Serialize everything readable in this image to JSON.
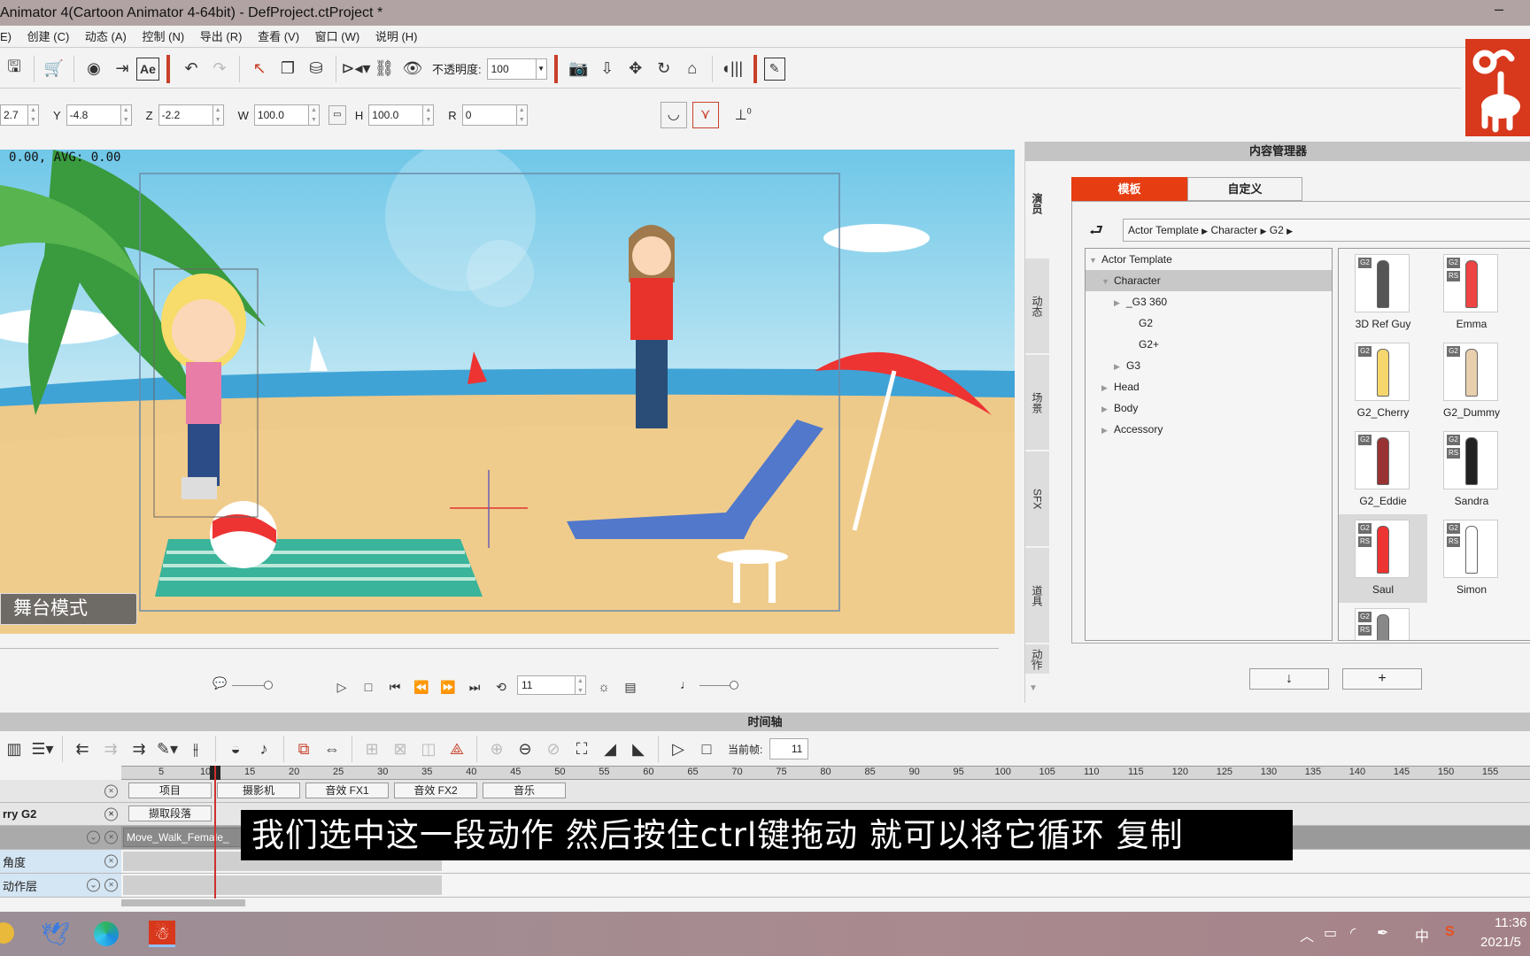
{
  "window": {
    "title": "Animator 4(Cartoon Animator 4-64bit) - DefProject.ctProject *",
    "minimize": "–"
  },
  "menu": [
    "E)",
    "创建 (C)",
    "动态 (A)",
    "控制 (N)",
    "导出 (R)",
    "查看 (V)",
    "窗口 (W)",
    "说明 (H)"
  ],
  "toolbar": {
    "ae_label": "Ae",
    "opacity_label": "不透明度:",
    "opacity_value": "100"
  },
  "transform": {
    "x": "2.7",
    "y_label": "Y",
    "y": "-4.8",
    "z_label": "Z",
    "z": "-2.2",
    "w_label": "W",
    "w": "100.0",
    "h_label": "H",
    "h": "100.0",
    "r_label": "R",
    "r": "0",
    "angle_zero": "0"
  },
  "stage": {
    "fps": "0.00, AVG: 0.00",
    "mode": "舞台模式",
    "frame": "11"
  },
  "content_manager": {
    "title": "内容管理器",
    "side_tabs": [
      "演员",
      "动态",
      "场景",
      "SFX",
      "道具",
      "动作"
    ],
    "tabs": [
      "模板",
      "自定义"
    ],
    "breadcrumb": [
      "Actor Template",
      "Character",
      "G2"
    ],
    "tree": [
      {
        "label": "Actor Template",
        "expanded": true
      },
      {
        "label": "Character",
        "expanded": true,
        "selected": true
      },
      {
        "label": "_G3 360",
        "expandable": true
      },
      {
        "label": "G2"
      },
      {
        "label": "G2+"
      },
      {
        "label": "G3",
        "expandable": true
      },
      {
        "label": "Head",
        "expandable": true
      },
      {
        "label": "Body",
        "expandable": true
      },
      {
        "label": "Accessory",
        "expandable": true
      }
    ],
    "items": [
      {
        "name": "3D Ref Guy",
        "badges": [
          "G2"
        ]
      },
      {
        "name": "Emma",
        "badges": [
          "G2",
          "RS"
        ]
      },
      {
        "name": "G2_Cherry",
        "badges": [
          "G2"
        ]
      },
      {
        "name": "G2_Dummy",
        "badges": [
          "G2"
        ]
      },
      {
        "name": "G2_Eddie",
        "badges": [
          "G2"
        ]
      },
      {
        "name": "Sandra",
        "badges": [
          "G2",
          "RS"
        ]
      },
      {
        "name": "Saul",
        "badges": [
          "G2",
          "RS"
        ],
        "selected": true
      },
      {
        "name": "Simon",
        "badges": [
          "G2",
          "RS"
        ]
      },
      {
        "name": "",
        "badges": [
          "G2",
          "RS"
        ]
      }
    ],
    "download_label": "↓",
    "add_label": "+"
  },
  "timeline": {
    "title": "时间轴",
    "current_frame_label": "当前帧:",
    "current_frame": "11",
    "ruler": [
      5,
      10,
      15,
      20,
      25,
      30,
      35,
      40,
      45,
      50,
      55,
      60,
      65,
      70,
      75,
      80,
      85,
      90,
      95,
      100,
      105,
      110,
      115,
      120,
      125,
      130,
      135,
      140,
      145,
      150,
      155
    ],
    "track_buttons": [
      "项目",
      "摄影机",
      "音效 FX1",
      "音效 FX2",
      "音乐"
    ],
    "actor_label": "rry G2",
    "actor_button": "撷取段落",
    "motion_clip": "Move_Walk_Female_",
    "rows": [
      "角度",
      "动作层"
    ]
  },
  "subtitle": "我们选中这一段动作 然后按住ctrl键拖动 就可以将它循环 复制",
  "taskbar": {
    "time": "11:36",
    "date": "2021/5",
    "ime": "中"
  },
  "colors": {
    "accent": "#e63d12",
    "playhead": "#d03030"
  }
}
